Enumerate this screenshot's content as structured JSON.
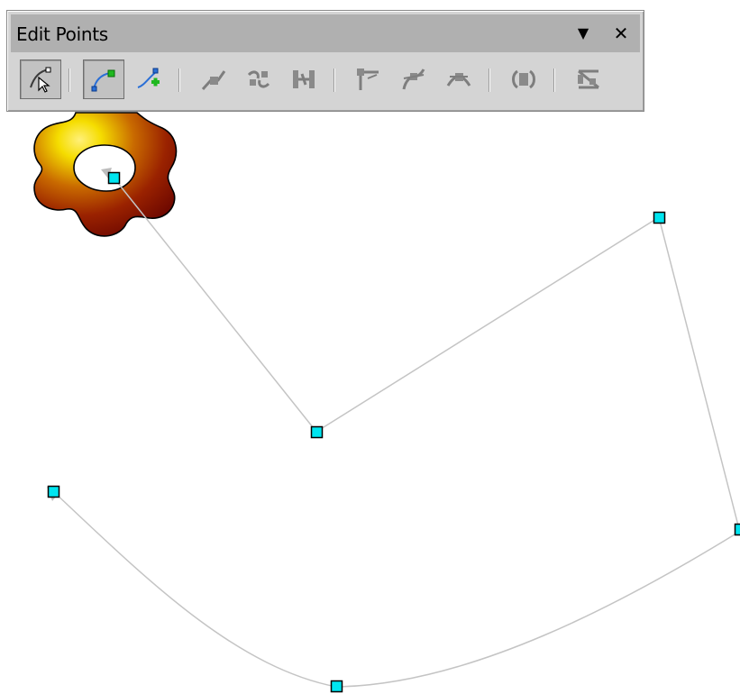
{
  "window": {
    "title": "Edit Points",
    "menu_glyph": "▼",
    "close_glyph": "✕"
  },
  "toolbar": {
    "groups": [
      [
        {
          "name": "points-tool",
          "icon": "select-points-icon",
          "pressed": true
        }
      ],
      [
        {
          "name": "move-points-tool",
          "icon": "move-points-icon",
          "pressed": true
        },
        {
          "name": "insert-points-tool",
          "icon": "insert-points-icon",
          "pressed": false
        }
      ],
      [
        {
          "name": "delete-points-tool",
          "icon": "delete-points-icon",
          "disabled": true
        },
        {
          "name": "split-curve-tool",
          "icon": "split-curve-icon",
          "disabled": true
        },
        {
          "name": "convert-to-curve-tool",
          "icon": "convert-to-curve-icon",
          "disabled": true
        }
      ],
      [
        {
          "name": "corner-point-tool",
          "icon": "corner-point-icon",
          "disabled": true
        },
        {
          "name": "smooth-transition-tool",
          "icon": "smooth-transition-icon",
          "disabled": true
        },
        {
          "name": "symmetric-transition-tool",
          "icon": "symmetric-transition-icon",
          "disabled": true
        }
      ],
      [
        {
          "name": "close-bezier-tool",
          "icon": "close-bezier-icon",
          "disabled": true
        }
      ],
      [
        {
          "name": "eliminate-points-tool",
          "icon": "eliminate-points-icon",
          "disabled": true
        }
      ]
    ]
  },
  "colors": {
    "handle_fill": "#00e5f0",
    "handle_stroke": "#000000",
    "path_stroke": "#c8c8c8",
    "flower_light": "#f5dd00",
    "flower_mid": "#b84800",
    "flower_dark": "#7a0c00",
    "toolbar_bg": "#d4d4d4",
    "titlebar_bg": "#b0b0b0"
  }
}
